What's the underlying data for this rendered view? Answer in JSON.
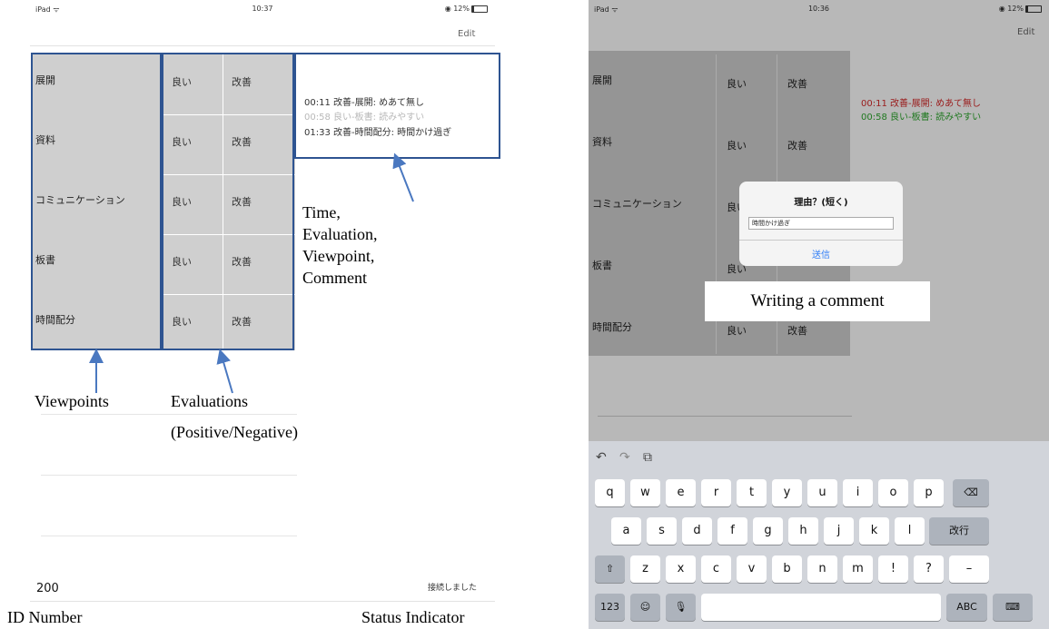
{
  "left": {
    "statusbar": {
      "carrier": "iPad ᯤ",
      "time": "10:37",
      "battery": "◉ 12%"
    },
    "edit_label": "Edit",
    "viewpoints": [
      "展開",
      "資料",
      "コミュニケーション",
      "板書",
      "時間配分"
    ],
    "good_label": "良い",
    "improve_label": "改善",
    "log": [
      {
        "text": "00:11 改善-展開: めあて無し",
        "color": "#333333"
      },
      {
        "text": "00:58 良い-板書: 読みやすい",
        "color": "#b8b8b8"
      },
      {
        "text": "01:33 改善-時間配分: 時間かけ過ぎ",
        "color": "#333333"
      }
    ],
    "id_number": "200",
    "status_text": "接続しました"
  },
  "annotations": {
    "log_caption": [
      "Time,",
      "Evaluation,",
      "Viewpoint,",
      "Comment"
    ],
    "viewpoints_caption": "Viewpoints",
    "evaluations_caption": [
      "Evaluations",
      "(Positive/Negative)"
    ],
    "id_caption": "ID Number",
    "status_caption": "Status Indicator",
    "comment_caption": "Writing a comment",
    "box_color": "#2e5491"
  },
  "right": {
    "statusbar": {
      "carrier": "iPad ᯤ",
      "time": "10:36",
      "battery": "◉ 12%"
    },
    "edit_label": "Edit",
    "viewpoints": [
      "展開",
      "資料",
      "コミュニケーション",
      "板書",
      "時間配分"
    ],
    "good_label": "良い",
    "improve_label": "改善",
    "log": [
      {
        "text": "00:11 改善-展開: めあて無し",
        "color": "#d62a2a"
      },
      {
        "text": "00:58 良い-板書: 読みやすい",
        "color": "#2ea82e"
      }
    ],
    "dialog": {
      "title": "理由？(短く)",
      "input_value": "時間かけ過ぎ",
      "send_label": "送信"
    },
    "keyboard": {
      "row1": [
        "q",
        "w",
        "e",
        "r",
        "t",
        "y",
        "u",
        "i",
        "o",
        "p"
      ],
      "row2": [
        "a",
        "s",
        "d",
        "f",
        "g",
        "h",
        "j",
        "k",
        "l"
      ],
      "row3": [
        "z",
        "x",
        "c",
        "v",
        "b",
        "n",
        "m",
        "!",
        "?"
      ],
      "return_label": "改行",
      "numbers_label": "123",
      "abc_label": "ABC",
      "dash_label": "–",
      "undo_icon": "↶",
      "redo_icon": "↷",
      "paste_icon": "⧉",
      "backspace_icon": "⌫",
      "shift_icon": "⇧",
      "emoji_icon": "☺",
      "mic_icon": "🎙",
      "dismiss_icon": "⌨"
    }
  }
}
